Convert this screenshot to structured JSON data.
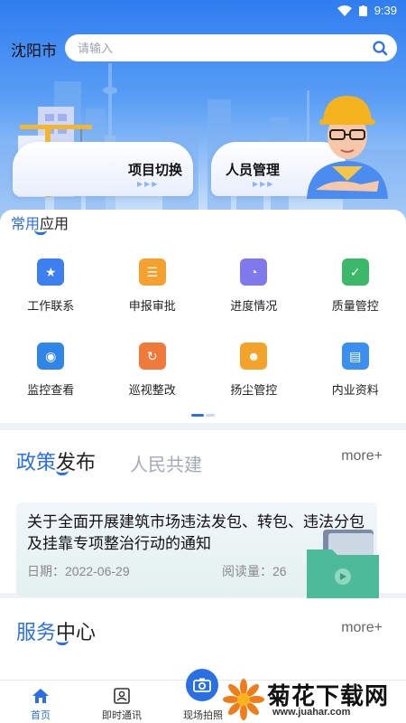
{
  "status": {
    "time": "9:39"
  },
  "header": {
    "city": "沈阳市",
    "search_placeholder": "请输入",
    "cards": [
      {
        "label": "项目切换"
      },
      {
        "label": "人员管理"
      }
    ]
  },
  "common_apps": {
    "title_highlight": "常用",
    "title_rest": "应用",
    "items": [
      {
        "label": "工作联系",
        "icon": "star-folder-icon",
        "color": "#3b7ff0"
      },
      {
        "label": "申报审批",
        "icon": "approval-icon",
        "color": "#f4a12f"
      },
      {
        "label": "进度情况",
        "icon": "progress-icon",
        "color": "#7f79ec"
      },
      {
        "label": "质量管控",
        "icon": "quality-shield-icon",
        "color": "#3cb86a"
      },
      {
        "label": "监控查看",
        "icon": "monitor-eye-icon",
        "color": "#2f86e8"
      },
      {
        "label": "巡视整改",
        "icon": "patrol-calendar-icon",
        "color": "#f07a3c"
      },
      {
        "label": "扬尘管控",
        "icon": "people-group-icon",
        "color": "#f3a32c"
      },
      {
        "label": "内业资料",
        "icon": "document-folder-icon",
        "color": "#3b8ff0"
      }
    ]
  },
  "policy": {
    "tab_active_highlight": "政策",
    "tab_active_rest": "发布",
    "tab_inactive": "人民共建",
    "more": "more+",
    "news": {
      "title": "关于全面开展建筑市场违法发包、转包、违法分包及挂靠专项整治行动的通知",
      "date": "日期：2022-06-29",
      "reads": "阅读量：26"
    }
  },
  "service": {
    "title_highlight": "服务",
    "title_rest": "中心",
    "more": "more+"
  },
  "bottom_nav": {
    "items": [
      {
        "label": "首页"
      },
      {
        "label": "即时通讯"
      },
      {
        "label": "现场拍照"
      }
    ]
  },
  "watermark": {
    "name": "菊花下载网",
    "url": "www.juahar.com"
  },
  "colors": {
    "accent": "#2a6fe3"
  }
}
